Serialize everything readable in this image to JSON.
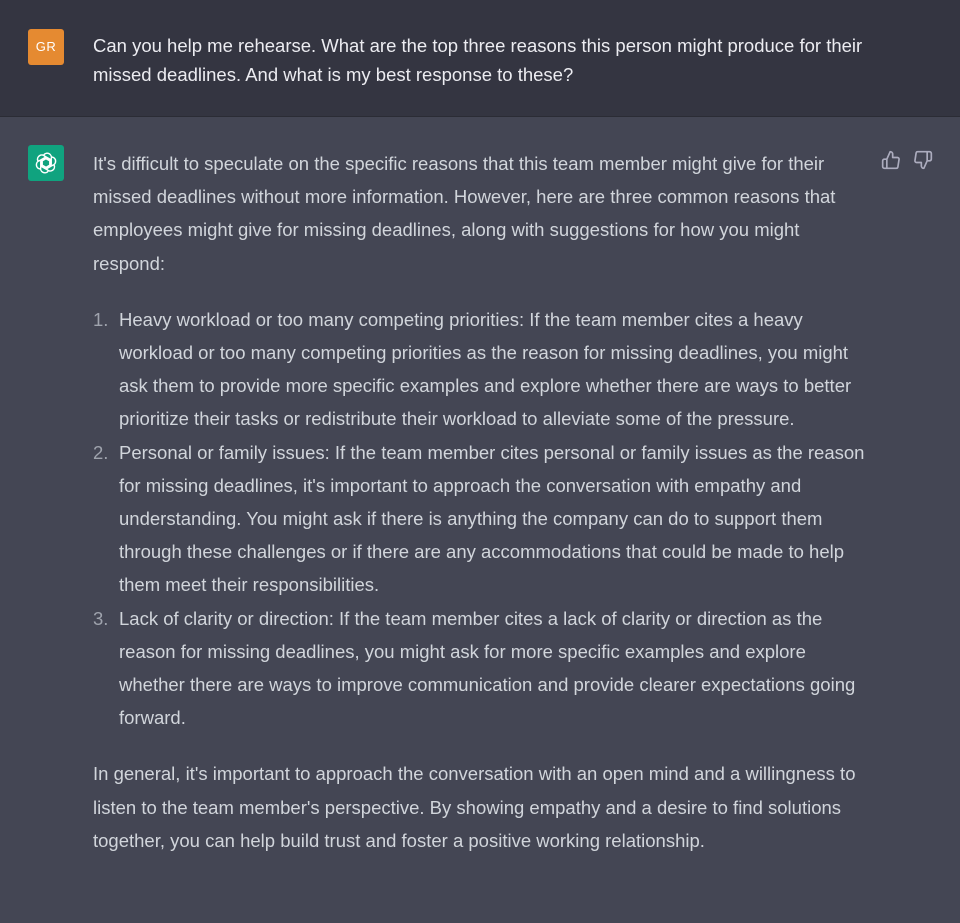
{
  "user_message": {
    "avatar_initials": "GR",
    "avatar_color": "#e58a31",
    "text": "Can you help me rehearse. What are the top three reasons this person might produce for their missed deadlines. And what is my best response to these?"
  },
  "assistant_message": {
    "avatar_icon": "openai-logo-icon",
    "avatar_color": "#10a37f",
    "intro": "It's difficult to speculate on the specific reasons that this team member might give for their missed deadlines without more information. However, here are three common reasons that employees might give for missing deadlines, along with suggestions for how you might respond:",
    "reasons": [
      {
        "number": "1.",
        "text": "Heavy workload or too many competing priorities: If the team member cites a heavy workload or too many competing priorities as the reason for missing deadlines, you might ask them to provide more specific examples and explore whether there are ways to better prioritize their tasks or redistribute their workload to alleviate some of the pressure."
      },
      {
        "number": "2.",
        "text": "Personal or family issues: If the team member cites personal or family issues as the reason for missing deadlines, it's important to approach the conversation with empathy and understanding. You might ask if there is anything the company can do to support them through these challenges or if there are any accommodations that could be made to help them meet their responsibilities."
      },
      {
        "number": "3.",
        "text": "Lack of clarity or direction: If the team member cites a lack of clarity or direction as the reason for missing deadlines, you might ask for more specific examples and explore whether there are ways to improve communication and provide clearer expectations going forward."
      }
    ],
    "conclusion": "In general, it's important to approach the conversation with an open mind and a willingness to listen to the team member's perspective. By showing empathy and a desire to find solutions together, you can help build trust and foster a positive working relationship."
  },
  "feedback": {
    "like_icon": "thumbs-up-icon",
    "dislike_icon": "thumbs-down-icon"
  }
}
